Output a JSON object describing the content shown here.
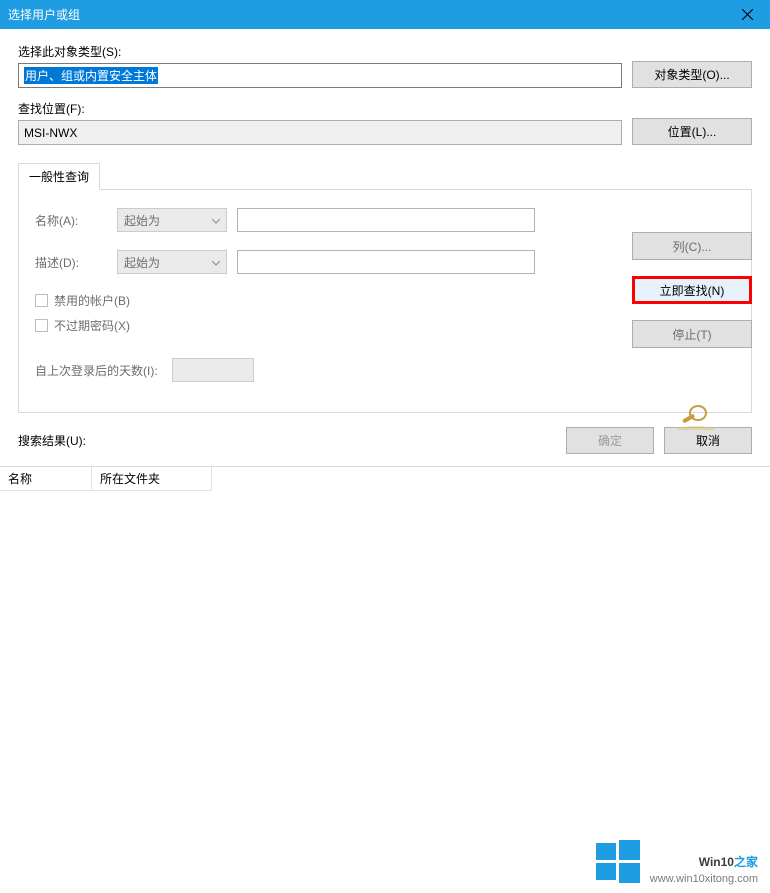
{
  "titlebar": {
    "title": "选择用户或组"
  },
  "objectType": {
    "label": "选择此对象类型(S):",
    "value": "用户、组或内置安全主体",
    "button": "对象类型(O)..."
  },
  "location": {
    "label": "查找位置(F):",
    "value": "MSI-NWX",
    "button": "位置(L)..."
  },
  "tab": {
    "label": "一般性查询"
  },
  "query": {
    "nameLabel": "名称(A):",
    "nameMode": "起始为",
    "descLabel": "描述(D):",
    "descMode": "起始为",
    "disabledAccounts": "禁用的帐户(B)",
    "neverExpire": "不过期密码(X)",
    "daysLabel": "自上次登录后的天数(I):"
  },
  "buttons": {
    "columns": "列(C)...",
    "findNow": "立即查找(N)",
    "stop": "停止(T)",
    "ok": "确定",
    "cancel": "取消"
  },
  "results": {
    "label": "搜索结果(U):",
    "colName": "名称",
    "colFolder": "所在文件夹"
  },
  "watermark": {
    "brand1": "Win10",
    "brand2": "之家",
    "url": "www.win10xitong.com"
  }
}
